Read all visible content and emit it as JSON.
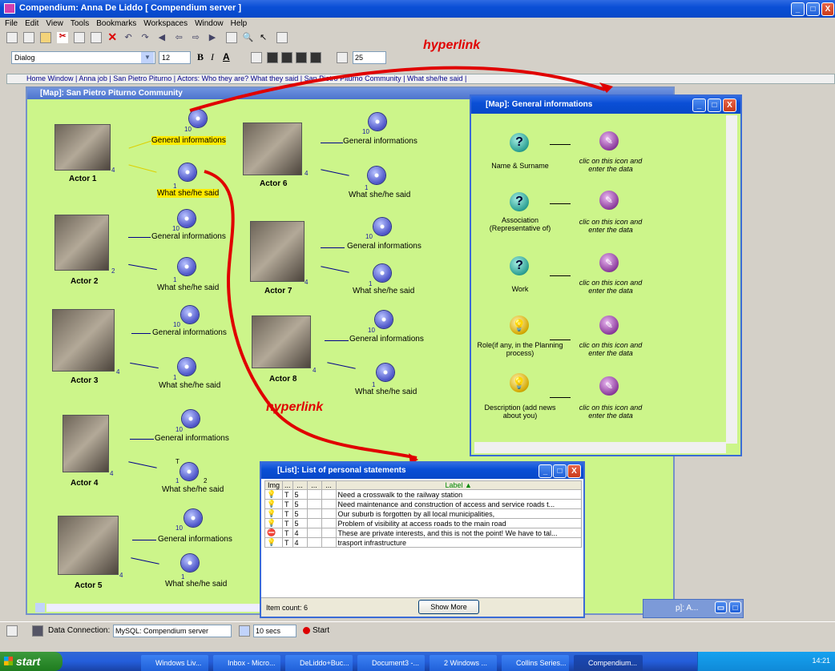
{
  "window": {
    "title": "Compendium: Anna De Liddo [ Compendium server ]"
  },
  "menu": [
    "File",
    "Edit",
    "View",
    "Tools",
    "Bookmarks",
    "Workspaces",
    "Window",
    "Help"
  ],
  "format": {
    "font": "Dialog",
    "size": "12",
    "bold": "B",
    "italic": "I",
    "underline": "A",
    "spacing": "25"
  },
  "breadcrumb": [
    "Home Window",
    "Anna job",
    "San Pietro Piturno",
    "Actors: Who they are? What they said",
    "San Pietro Piturno Community",
    "What she/he said"
  ],
  "annotations": {
    "hyperlink_top": "hyperlink",
    "hyperlink_mid": "hyperlink"
  },
  "main_map": {
    "title": "[Map]: San Pietro Piturno Community",
    "actors": [
      {
        "name": "Actor 1",
        "count": "4",
        "info_count": "10",
        "info": "General informations",
        "said_count": "1",
        "said": "What she/he said"
      },
      {
        "name": "Actor 2",
        "count": "2",
        "info_count": "10",
        "info": "General informations",
        "said_count": "1",
        "said": "What she/he said"
      },
      {
        "name": "Actor 3",
        "count": "4",
        "info_count": "10",
        "info": "General informations",
        "said_count": "1",
        "said": "What she/he said"
      },
      {
        "name": "Actor 4",
        "count": "4",
        "info_count": "10",
        "info": "General informations",
        "said_count": "1",
        "said_count2": "2",
        "said_mark": "T",
        "said": "What she/he said"
      },
      {
        "name": "Actor 5",
        "count": "4",
        "info_count": "10",
        "info": "General informations",
        "said_count": "1",
        "said": "What she/he said"
      },
      {
        "name": "Actor 6",
        "count": "4",
        "info_count": "10",
        "info": "General informations",
        "said_count": "1",
        "said": "What she/he said"
      },
      {
        "name": "Actor 7",
        "count": "4",
        "info_count": "10",
        "info": "General informations",
        "said_count": "1",
        "said": "What she/he said"
      },
      {
        "name": "Actor 8",
        "count": "4",
        "info_count": "10",
        "info": "General informations",
        "said_count": "1",
        "said": "What she/he said"
      }
    ]
  },
  "info_map": {
    "title": "[Map]: General informations",
    "rows": [
      {
        "label": "Name & Surname",
        "hint": "clic on this icon and enter the data",
        "icon": "question-icon"
      },
      {
        "label": "Association (Representative of)",
        "hint": "clic on this icon and enter the data",
        "icon": "question-icon"
      },
      {
        "label": "Work",
        "hint": "clic on this icon and enter the data",
        "icon": "question-icon"
      },
      {
        "label": "Role(if any, in the Planning process)",
        "hint": "clic on this icon and enter the data",
        "icon": "lightbulb-icon"
      },
      {
        "label": "Description (add news about you)",
        "hint": "clic on this icon and enter the data",
        "icon": "lightbulb-icon"
      }
    ]
  },
  "list_window": {
    "title": "[List]: List of personal statements",
    "headers": [
      "Img",
      "...",
      "...",
      "...",
      "...",
      "Label ▲"
    ],
    "rows": [
      {
        "type": "idea",
        "t": "T",
        "n": "5",
        "label": "Need a crosswalk to the railway station"
      },
      {
        "type": "idea",
        "t": "T",
        "n": "5",
        "label": "Need maintenance and construction of access and service roads t..."
      },
      {
        "type": "idea",
        "t": "T",
        "n": "5",
        "label": "Our suburb is forgotten by all local municipalities,"
      },
      {
        "type": "idea",
        "t": "T",
        "n": "5",
        "label": "Problem of visibility at access roads to the main road"
      },
      {
        "type": "con",
        "t": "T",
        "n": "4",
        "label": "These are private interests, and this is not the point! We have to tal..."
      },
      {
        "type": "idea",
        "t": "T",
        "n": "4",
        "label": "trasport infrastructure"
      }
    ],
    "item_count": "Item count: 6",
    "show_more": "Show More"
  },
  "minimized": {
    "label": "p]:  A..."
  },
  "status": {
    "data_connection_label": "Data Connection:",
    "connection": "MySQL: Compendium server",
    "interval": "10 secs",
    "start": "Start"
  },
  "taskbar": {
    "start": "start",
    "items": [
      "Windows Liv...",
      "Inbox - Micro...",
      "DeLiddo+Buc...",
      "Document3 -...",
      "2 Windows ...",
      "Collins Series...",
      "Compendium..."
    ],
    "active_index": 6,
    "clock": "14:21"
  },
  "colors": {
    "map_bg": "#ccf58a",
    "hyperlink": "#e00000",
    "title_blue": "#0a4fd6"
  }
}
